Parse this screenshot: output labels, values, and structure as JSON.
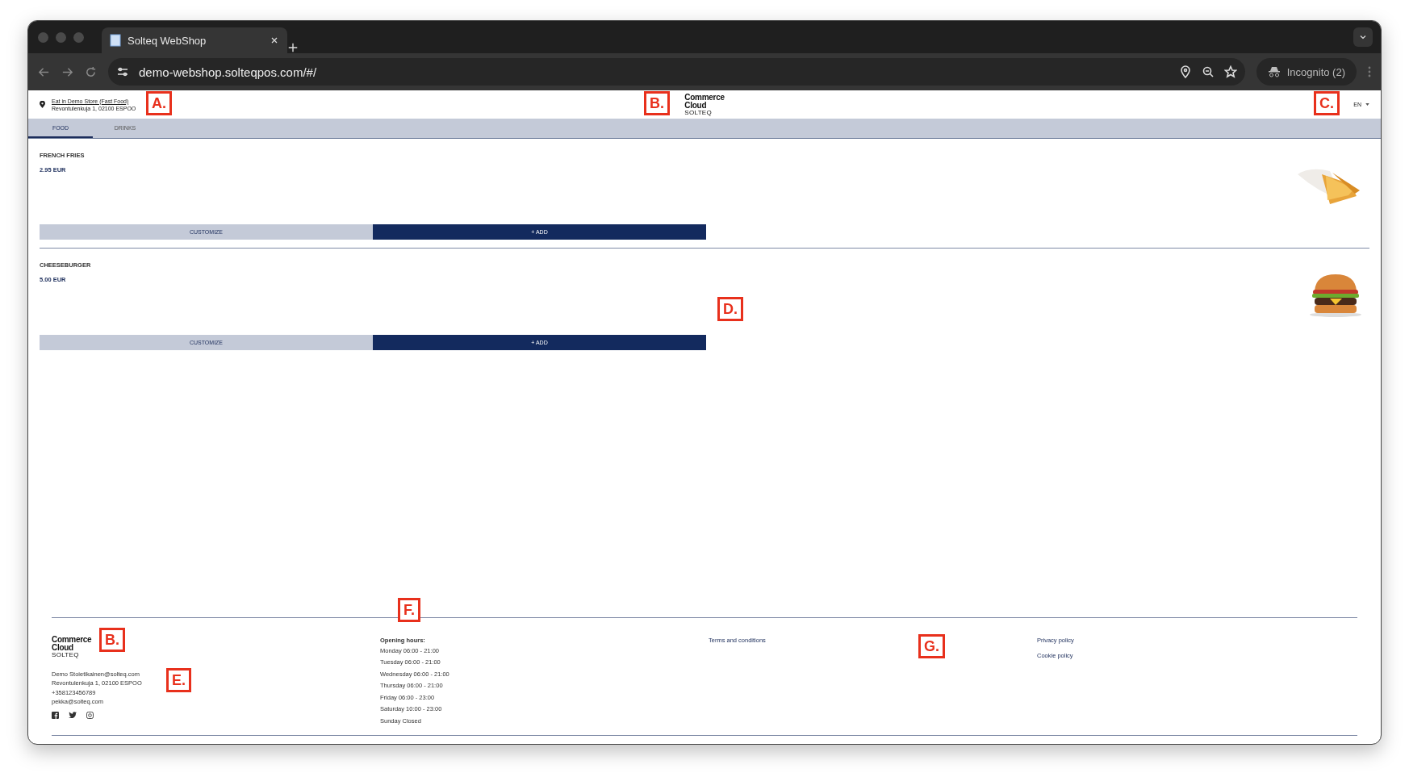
{
  "browser": {
    "tab_title": "Solteq WebShop",
    "url": "demo-webshop.solteqpos.com/#/",
    "profile": "Incognito (2)"
  },
  "header": {
    "store_name": "Eat in Demo Store (Fast Food)",
    "store_address": "Revontulenkuja 1, 02100 ESPOO",
    "logo": {
      "line1": "Commerce",
      "line2": "Cloud",
      "line3": "SOLTEQ"
    },
    "language": "EN"
  },
  "tabs": [
    {
      "label": "FOOD",
      "selected": true
    },
    {
      "label": "DRINKS",
      "selected": false
    }
  ],
  "products": [
    {
      "name": "FRENCH FRIES",
      "price": "2.95 EUR",
      "kind": "fries",
      "customize": "CUSTOMIZE",
      "add": "+ ADD"
    },
    {
      "name": "CHEESEBURGER",
      "price": "5.00 EUR",
      "kind": "burger",
      "customize": "CUSTOMIZE",
      "add": "+ ADD"
    }
  ],
  "footer": {
    "logo": {
      "line1": "Commerce",
      "line2": "Cloud",
      "line3": "SOLTEQ"
    },
    "contact": [
      "Demo Stoietikainen@solteq.com",
      "Revontulenkuja 1, 02100 ESPOO",
      "+358123456789",
      "pekka@solteq.com"
    ],
    "opening_title": "Opening hours:",
    "opening_hours": [
      "Monday 06:00 - 21:00",
      "Tuesday 06:00 - 21:00",
      "Wednesday 06:00 - 21:00",
      "Thursday 06:00 - 21:00",
      "Friday 06:00 - 23:00",
      "Saturday 10:00 - 23:00",
      "Sunday Closed"
    ],
    "links_1": [
      "Terms and conditions"
    ],
    "links_2": [
      "Privacy policy",
      "Cookie policy"
    ]
  },
  "annotations": [
    "A.",
    "B.",
    "C.",
    "D.",
    "B.",
    "E.",
    "F.",
    "G."
  ]
}
